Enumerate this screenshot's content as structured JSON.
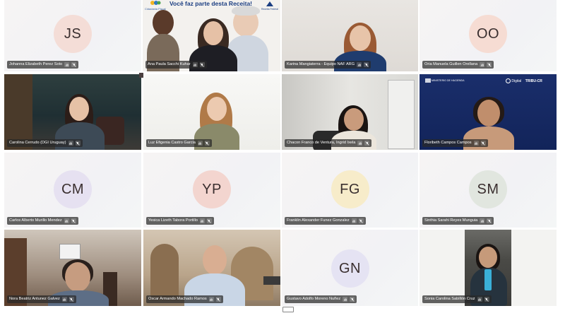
{
  "banner": {
    "title": "Você faz parte desta Receita!",
    "logo_left": "Cidadania Fiscal",
    "logo_right": "Receita Federal"
  },
  "blue_banner": {
    "ministry": "MINISTERIO DE HACIENDA",
    "logo_text": "TRIBU-CR",
    "brand": "Digital"
  },
  "participants": [
    {
      "name": "Johanna Elizabeth Perez Soto",
      "initials": "JS",
      "avatar_color": "#f4ddd7"
    },
    {
      "name": "Ana Paula Sacchi Kuhar",
      "initials": "",
      "avatar_color": ""
    },
    {
      "name": "Karina Mangiaterra - Equipo NAF ARG",
      "initials": "",
      "avatar_color": ""
    },
    {
      "name": "Oria Manuela Guillen Orellana",
      "initials": "OO",
      "avatar_color": "#f6dcd3"
    },
    {
      "name": "Carolina Cerrudo (DGI Uruguay)",
      "initials": "",
      "avatar_color": ""
    },
    {
      "name": "Luz Efigenia Castro Garcia",
      "initials": "",
      "avatar_color": ""
    },
    {
      "name": "Chacon Franco de Ventura, Ingrid Ixela",
      "initials": "",
      "avatar_color": ""
    },
    {
      "name": "Floribeth Campos Campos",
      "initials": "",
      "avatar_color": ""
    },
    {
      "name": "Carlos Alberto Murillo Mendez",
      "initials": "CM",
      "avatar_color": "#e6e1f1"
    },
    {
      "name": "Yesica Lizeth Tabora Portillo",
      "initials": "YP",
      "avatar_color": "#f3d5cf"
    },
    {
      "name": "Franklin Alexander Funez Gonzalez",
      "initials": "FG",
      "avatar_color": "#f7ecca"
    },
    {
      "name": "Sinthia Sarahi Reyes Munguia",
      "initials": "SM",
      "avatar_color": "#e1e6df"
    },
    {
      "name": "Nora Beatriz Antunez Galvez",
      "initials": "",
      "avatar_color": ""
    },
    {
      "name": "Oscar Armando Machado Ramos",
      "initials": "",
      "avatar_color": ""
    },
    {
      "name": "Gustavo Adolfo Moreno Nuñez",
      "initials": "GN",
      "avatar_color": "#e5e3f3"
    },
    {
      "name": "Sonia Carolina Sabillón Cruz",
      "initials": "",
      "avatar_color": ""
    }
  ]
}
